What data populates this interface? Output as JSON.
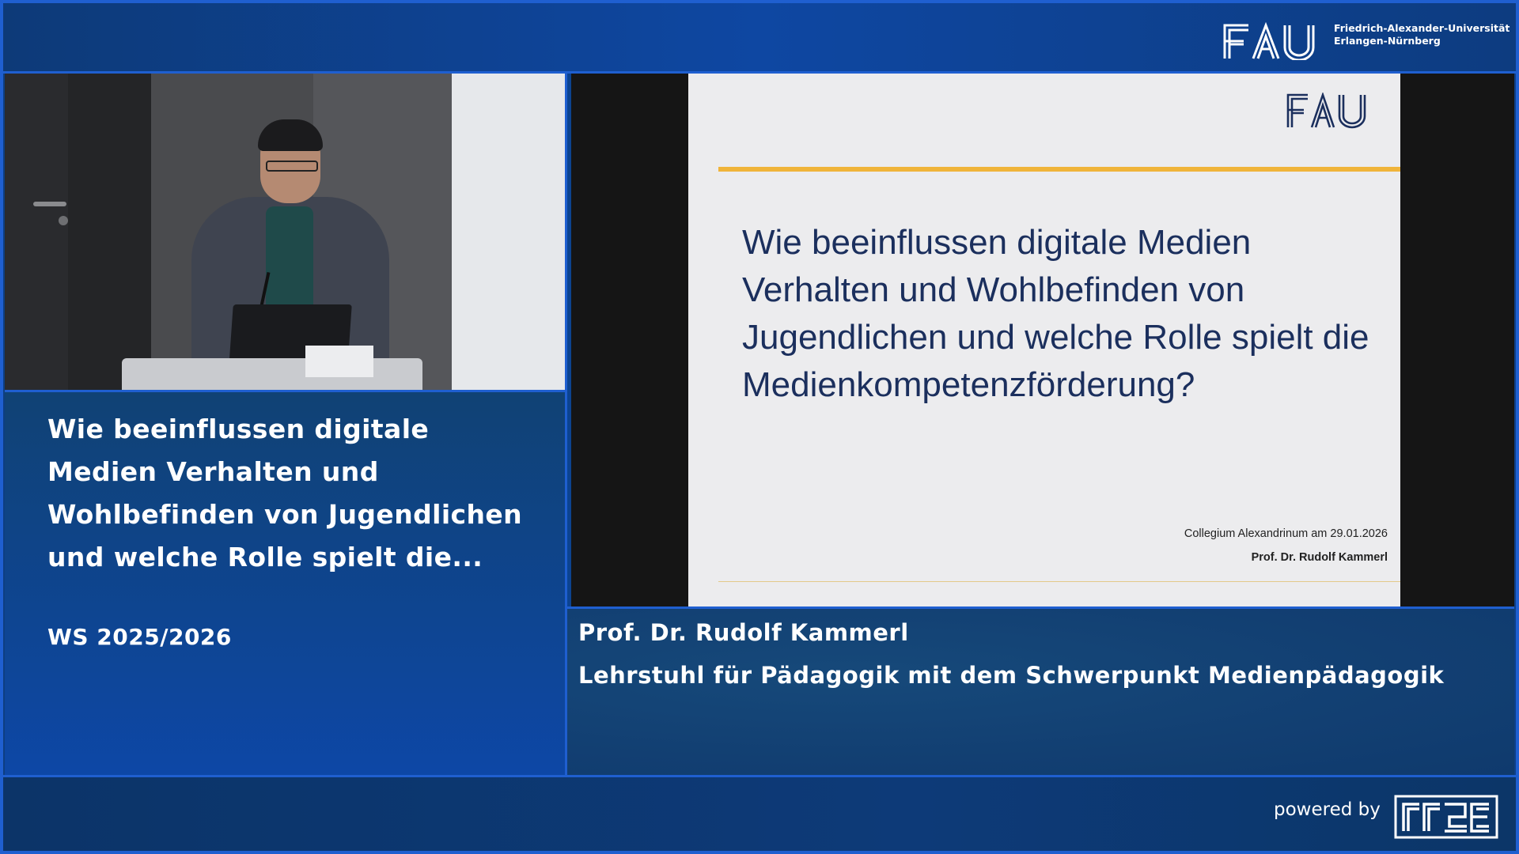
{
  "header": {
    "logo_mark": "FAU",
    "university_line1": "Friedrich-Alexander-Universität",
    "university_line2": "Erlangen-Nürnberg"
  },
  "lecture": {
    "title": "Wie beeinflussen digitale Medien Verhalten und Wohlbefinden von Jugendlichen und welche Rolle spielt die...",
    "semester": "WS 2025/2026"
  },
  "slide": {
    "logo_mark": "FAU",
    "title": "Wie beeinflussen digitale Medien Verhalten und Wohlbefinden von Jugendlichen und welche Rolle spielt die Medienkompetenzförderung?",
    "event": "Collegium Alexandrinum am 29.01.2026",
    "speaker": "Prof. Dr. Rudolf Kammerl",
    "accent_color": "#f0b43a",
    "title_color": "#1b2f5d"
  },
  "speaker": {
    "name": "Prof. Dr. Rudolf Kammerl",
    "chair": "Lehrstuhl für Pädagogik mit dem Schwerpunkt Medienpädagogik"
  },
  "footer": {
    "powered_by": "powered by",
    "logo_mark": "RRZE"
  },
  "colors": {
    "frame_border": "#1f5fd0",
    "background": "#0c3e86"
  }
}
